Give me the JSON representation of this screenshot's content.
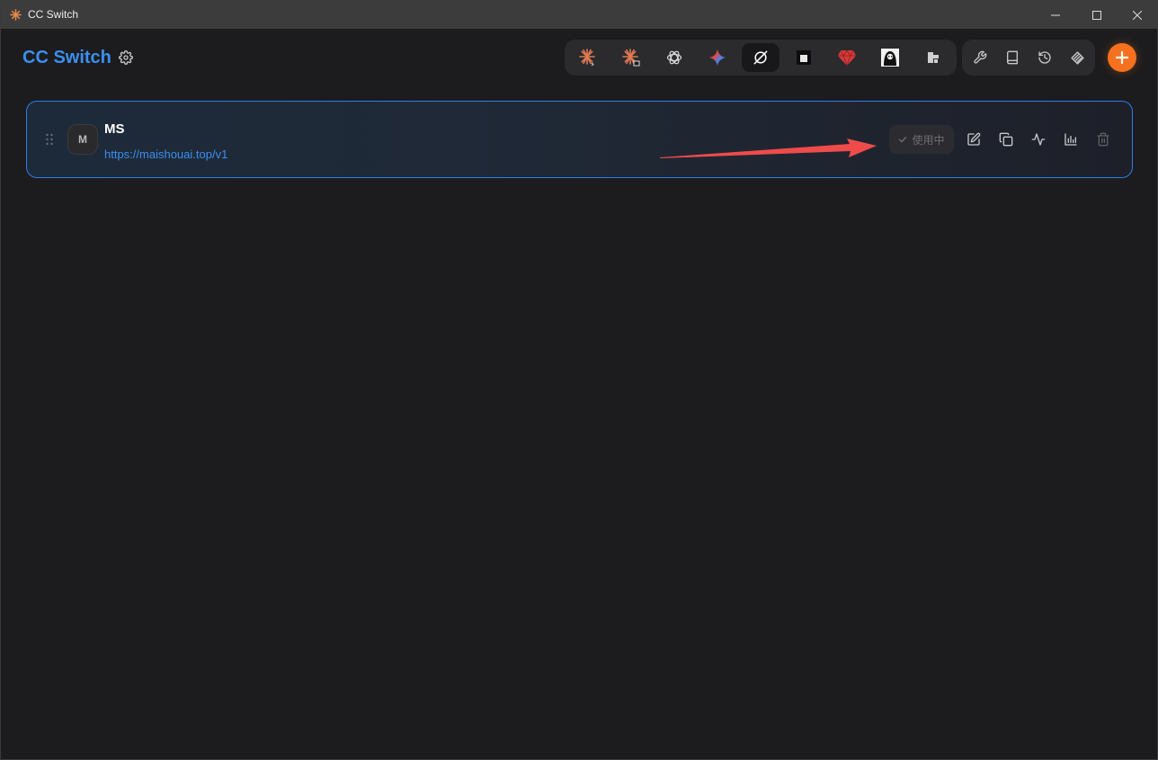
{
  "window": {
    "title": "CC Switch"
  },
  "header": {
    "brand": "CC Switch"
  },
  "provider": {
    "avatar_letter": "M",
    "name": "MS",
    "url": "https://maishouai.top/v1",
    "status_label": "使用中"
  },
  "colors": {
    "accent": "#3b8ff0",
    "add_button": "#f5711f",
    "arrow": "#f04b4b"
  }
}
